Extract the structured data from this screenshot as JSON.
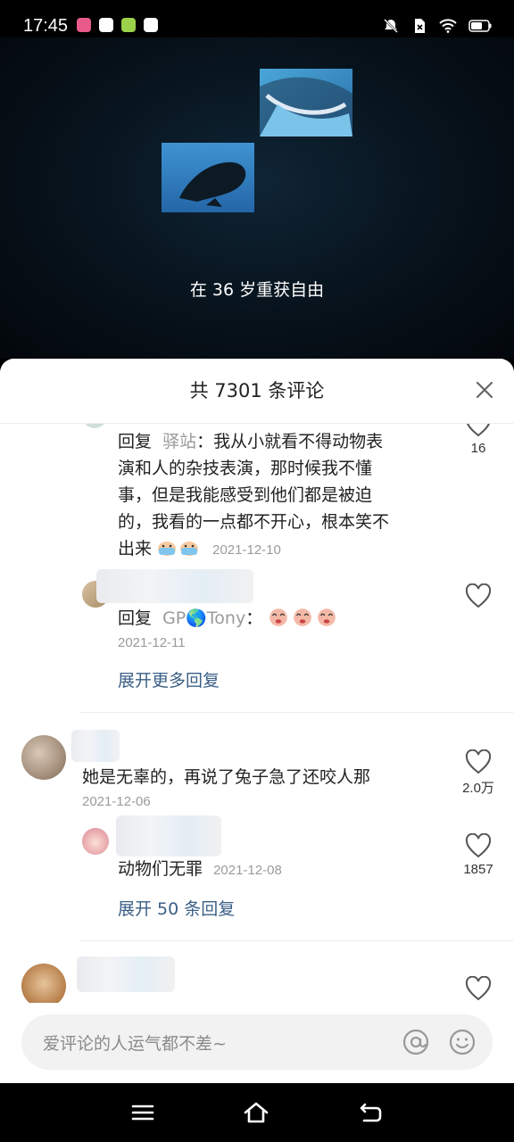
{
  "status_bar": {
    "time": "17:45"
  },
  "video": {
    "caption": "在 36 岁重获自由"
  },
  "comments_panel": {
    "title": "共 7301 条评论",
    "thread1": {
      "reply1": {
        "prefix": "回复",
        "to_user": "驿站",
        "lines": [
          "：我从小就看不得动物表",
          "演和人的杂技表演，那时候我不懂",
          "事，但是我能感受到他们都是被迫",
          "的，我看的一点都不开心，根本笑不",
          "出来"
        ],
        "date": "2021-12-10",
        "likes": "16"
      },
      "reply2": {
        "prefix": "回复",
        "to_user": "GP🌎Tony",
        "colon": "：",
        "date": "2021-12-11"
      },
      "expand_label": "展开更多回复"
    },
    "comment2": {
      "text": "她是无辜的，再说了兔子急了还咬人那",
      "date": "2021-12-06",
      "likes": "2.0万",
      "reply": {
        "text": "动物们无罪",
        "date": "2021-12-08",
        "likes": "1857"
      },
      "expand_label": "展开 50 条回复"
    }
  },
  "input": {
    "placeholder": "爱评论的人运气都不差~"
  }
}
